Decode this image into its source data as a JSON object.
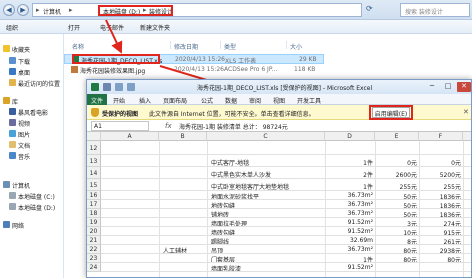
{
  "explorer": {
    "breadcrumb": [
      "计算机",
      "本地磁盘 (D:)",
      "装修设计"
    ],
    "search_placeholder": "搜索 装修设计",
    "toolbar": [
      "组织",
      "打开",
      "电子邮件",
      "新建文件夹"
    ],
    "nav": [
      {
        "label": "收藏夹",
        "icon": "star-icon"
      },
      {
        "label": "下载",
        "icon": "download-folder-icon"
      },
      {
        "label": "桌面",
        "icon": "desktop-icon"
      },
      {
        "label": "最近访问的位置",
        "icon": "recent-places-icon"
      },
      {
        "label": "库",
        "icon": "library-icon"
      },
      {
        "label": "暴风看电影",
        "icon": "video-library-icon"
      },
      {
        "label": "视频",
        "icon": "video-folder-icon"
      },
      {
        "label": "图片",
        "icon": "pictures-folder-icon"
      },
      {
        "label": "文档",
        "icon": "documents-folder-icon"
      },
      {
        "label": "音乐",
        "icon": "music-folder-icon"
      },
      {
        "label": "计算机",
        "icon": "computer-icon"
      },
      {
        "label": "本地磁盘 (C:)",
        "icon": "drive-c-icon"
      },
      {
        "label": "本地磁盘 (D:)",
        "icon": "drive-d-icon"
      },
      {
        "label": "网络",
        "icon": "network-icon"
      }
    ],
    "columns": [
      "名称",
      "修改日期",
      "类型",
      "大小"
    ],
    "files": [
      {
        "name": "海秀花园-1期_DECO_LIST.xls",
        "date": "2020/4/13 15:26",
        "type": "XLS 工作表",
        "size": "29 KB",
        "selected": true
      },
      {
        "name": "海秀花园装修效果图.jpg",
        "date": "2020/4/13 15:26",
        "type": "ACDSee Pro 6 JP...",
        "size": "118 KB",
        "selected": false
      }
    ]
  },
  "excel": {
    "title": "海秀花园-1期_DECO_LIST.xls [受保护的视图] - Microsoft Excel",
    "tabs": [
      "文件",
      "开始",
      "插入",
      "页面布局",
      "公式",
      "数据",
      "审阅",
      "视图",
      "开发工具"
    ],
    "protect_title": "受保护的视图",
    "protect_message": "此文件源自 Internet 位置，可能不安全。单击查看详细信息。",
    "enable_edit_label": "启用编辑(E)",
    "namebox": "A1",
    "formula": "海秀花园-1期  装修清单    总计：  98724元",
    "column_headers": [
      "A",
      "B",
      "C",
      "D",
      "E",
      "F"
    ],
    "rows": [
      {
        "num": "12",
        "c": "",
        "d": "",
        "e": "",
        "f": "",
        "b": ""
      },
      {
        "num": "13",
        "c": "中式客厅-地毯",
        "d": "1件",
        "e": "0元",
        "f": "0元",
        "b": ""
      },
      {
        "num": "14",
        "c": "中式黑色实木单人沙发",
        "d": "2件",
        "e": "2600元",
        "f": "5200元",
        "b": ""
      },
      {
        "num": "15",
        "c": "中式卧室地毯客厅大地垫地毯",
        "d": "1件",
        "e": "255元",
        "f": "255元",
        "b": ""
      },
      {
        "num": "16",
        "c": "地面水泥砂浆找平",
        "d": "36.73m²",
        "e": "50元",
        "f": "1836元",
        "b": ""
      },
      {
        "num": "17",
        "c": "地砖勾缝",
        "d": "36.73m²",
        "e": "50元",
        "f": "1836元",
        "b": ""
      },
      {
        "num": "18",
        "c": "铺地砖",
        "d": "36.73m²",
        "e": "50元",
        "f": "1836元",
        "b": ""
      },
      {
        "num": "19",
        "c": "墙面拉毛处理",
        "d": "91.52m²",
        "e": "3元",
        "f": "274元",
        "b": ""
      },
      {
        "num": "20",
        "c": "墙砖勾缝",
        "d": "91.52m²",
        "e": "10元",
        "f": "915元",
        "b": ""
      },
      {
        "num": "21",
        "c": "踢脚线",
        "d": "32.69m",
        "e": "8元",
        "f": "261元",
        "b": ""
      },
      {
        "num": "22",
        "c": "吊顶",
        "d": "36.73m²",
        "e": "80元",
        "f": "2938元",
        "b": "人工辅材"
      },
      {
        "num": "23",
        "c": "门套基层",
        "d": "1件",
        "e": "80元",
        "f": "80元",
        "b": ""
      },
      {
        "num": "24",
        "c": "墙面乳胶漆",
        "d": "91.52m²",
        "e": "",
        "f": "",
        "b": ""
      }
    ]
  }
}
